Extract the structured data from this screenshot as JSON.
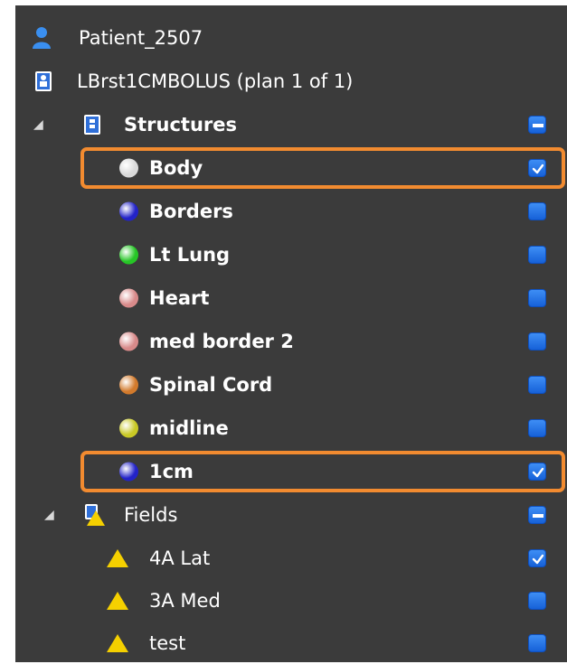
{
  "tree": {
    "patient": {
      "label": "Patient_2507",
      "icon": "person-icon"
    },
    "plan": {
      "label": "LBrst1CMBOLUS (plan 1 of 1)",
      "icon": "plan-icon"
    },
    "structures": {
      "label": "Structures",
      "expanded": true,
      "checkbox": "indeterminate",
      "items": [
        {
          "label": "Body",
          "color": "#d9d9d9",
          "checked": true,
          "highlighted": true
        },
        {
          "label": "Borders",
          "color": "#2323c8",
          "checked": false,
          "highlighted": false
        },
        {
          "label": "Lt Lung",
          "color": "#26c626",
          "checked": false,
          "highlighted": false
        },
        {
          "label": "Heart",
          "color": "#d88a8a",
          "checked": false,
          "highlighted": false
        },
        {
          "label": "med border 2",
          "color": "#d88a8a",
          "checked": false,
          "highlighted": false
        },
        {
          "label": "Spinal Cord",
          "color": "#d27a2c",
          "checked": false,
          "highlighted": false
        },
        {
          "label": "midline",
          "color": "#c9c925",
          "checked": false,
          "highlighted": false
        },
        {
          "label": "1cm",
          "color": "#2323c8",
          "checked": true,
          "highlighted": true
        }
      ]
    },
    "fields": {
      "label": "Fields",
      "expanded": true,
      "checkbox": "indeterminate",
      "items": [
        {
          "label": "4A Lat",
          "checked": true
        },
        {
          "label": "3A Med",
          "checked": false
        },
        {
          "label": "test",
          "checked": false
        }
      ]
    }
  },
  "colors": {
    "panel_bg": "#3b3b3b",
    "highlight": "#f28b30",
    "checkbox": "#1a6ee0",
    "field_triangle": "#f5d000"
  }
}
